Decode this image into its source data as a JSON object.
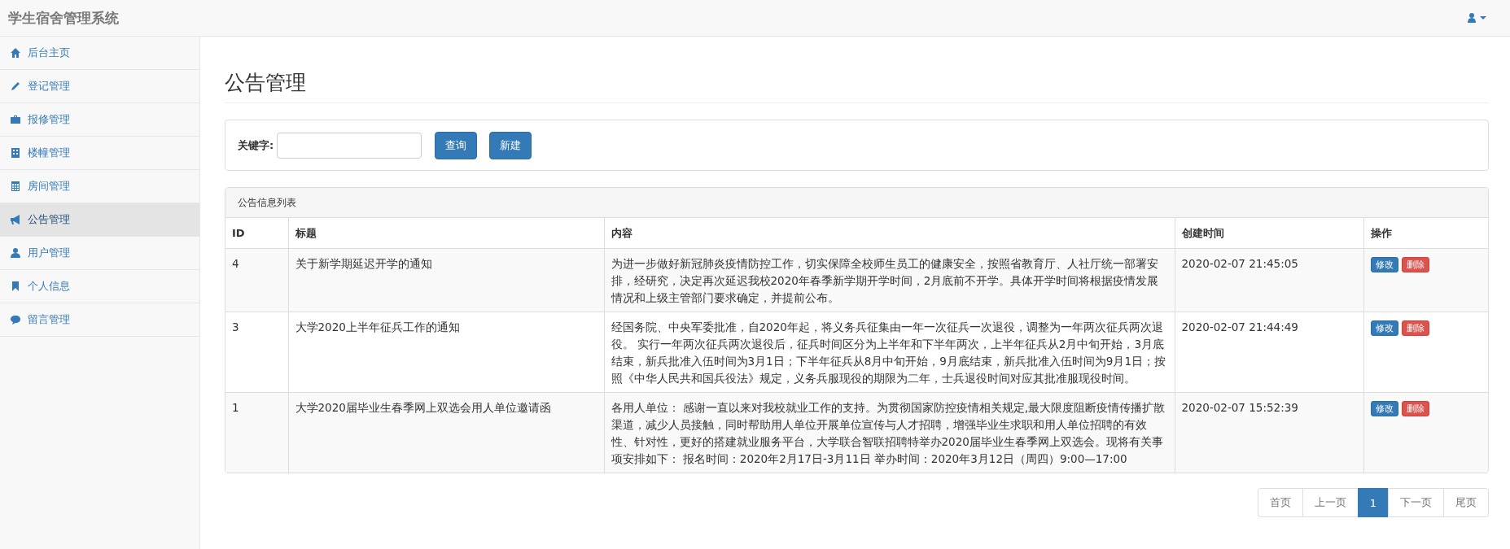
{
  "navbar": {
    "brand": "学生宿舍管理系统"
  },
  "sidebar": {
    "items": [
      {
        "label": "后台主页",
        "selected": false
      },
      {
        "label": "登记管理",
        "selected": false
      },
      {
        "label": "报修管理",
        "selected": false
      },
      {
        "label": "楼幢管理",
        "selected": false
      },
      {
        "label": "房间管理",
        "selected": false
      },
      {
        "label": "公告管理",
        "selected": true
      },
      {
        "label": "用户管理",
        "selected": false
      },
      {
        "label": "个人信息",
        "selected": false
      },
      {
        "label": "留言管理",
        "selected": false
      }
    ]
  },
  "page_title": "公告管理",
  "search": {
    "label": "关键字:",
    "buttons": [
      "查询",
      "新建"
    ]
  },
  "table": {
    "title": "公告信息列表",
    "columns": [
      "ID",
      "标题",
      "内容",
      "创建时间",
      "操作"
    ],
    "rows": [
      {
        "id": "4",
        "title": "关于新学期延迟开学的通知",
        "content": "为进一步做好新冠肺炎疫情防控工作，切实保障全校师生员工的健康安全，按照省教育厅、人社厅统一部署安排，经研究，决定再次延迟我校2020年春季新学期开学时间，2月底前不开学。具体开学时间将根据疫情发展情况和上级主管部门要求确定，并提前公布。",
        "created": "2020-02-07 21:45:05",
        "actions": [
          "修改",
          "删除"
        ]
      },
      {
        "id": "3",
        "title": "大学2020上半年征兵工作的通知",
        "content": "经国务院、中央军委批准，自2020年起，将义务兵征集由一年一次征兵一次退役，调整为一年两次征兵两次退役。 实行一年两次征兵两次退役后，征兵时间区分为上半年和下半年两次，上半年征兵从2月中旬开始，3月底结束，新兵批准入伍时间为3月1日；下半年征兵从8月中旬开始，9月底结束，新兵批准入伍时间为9月1日；按照《中华人民共和国兵役法》规定，义务兵服现役的期限为二年，士兵退役时间对应其批准服现役时间。",
        "created": "2020-02-07 21:44:49",
        "actions": [
          "修改",
          "删除"
        ]
      },
      {
        "id": "1",
        "title": "大学2020届毕业生春季网上双选会用人单位邀请函",
        "content": "各用人单位： 感谢一直以来对我校就业工作的支持。为贯彻国家防控疫情相关规定,最大限度阻断疫情传播扩散渠道，减少人员接触，同时帮助用人单位开展单位宣传与人才招聘，增强毕业生求职和用人单位招聘的有效性、针对性，更好的搭建就业服务平台，大学联合智联招聘特举办2020届毕业生春季网上双选会。现将有关事项安排如下： 报名时间：2020年2月17日-3月11日 举办时间：2020年3月12日（周四）9:00—17:00",
        "created": "2020-02-07 15:52:39",
        "actions": [
          "修改",
          "删除"
        ]
      }
    ]
  },
  "pagination": [
    {
      "label": "首页",
      "selected": false
    },
    {
      "label": "上一页",
      "selected": false
    },
    {
      "label": "1",
      "selected": true
    },
    {
      "label": "下一页",
      "selected": false
    },
    {
      "label": "尾页",
      "selected": false
    }
  ]
}
